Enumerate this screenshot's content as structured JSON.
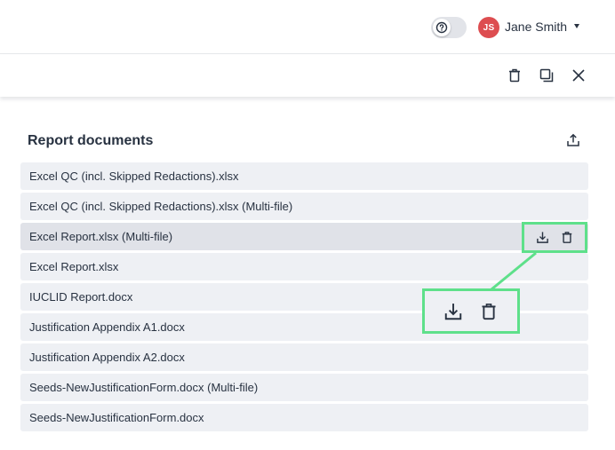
{
  "header": {
    "help_icon": "question-circle-icon",
    "avatar_initials": "JS",
    "avatar_color": "#dd4d50",
    "user_name": "Jane Smith"
  },
  "actions": {
    "icons": [
      "trash-icon",
      "copy-icon",
      "close-icon"
    ]
  },
  "panel": {
    "title": "Report documents",
    "export_icon": "upload-icon"
  },
  "documents": [
    "Excel QC (incl. Skipped Redactions).xlsx",
    "Excel QC (incl. Skipped Redactions).xlsx (Multi-file)",
    "Excel Report.xlsx (Multi-file)",
    "Excel Report.xlsx",
    "IUCLID Report.docx",
    "Justification Appendix A1.docx",
    "Justification Appendix A2.docx",
    "Seeds-NewJustificationForm.docx (Multi-file)",
    "Seeds-NewJustificationForm.docx"
  ],
  "row_actions": {
    "icons": [
      "download-icon",
      "trash-icon"
    ],
    "highlight_color": "#5ee08a"
  }
}
